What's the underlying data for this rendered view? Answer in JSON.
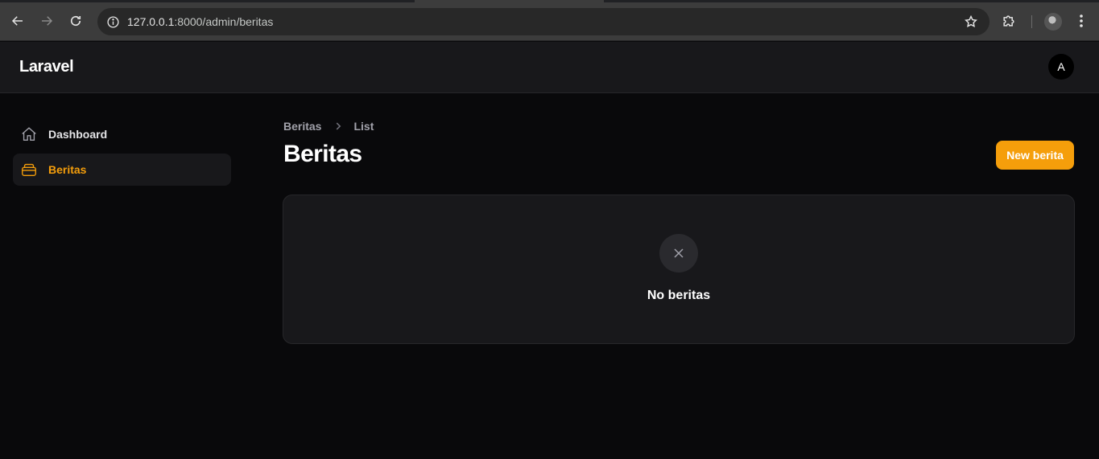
{
  "browser": {
    "url_host": "127.0.0.1",
    "url_rest": ":8000/admin/beritas",
    "icons": {
      "back": "arrow-left-icon",
      "forward": "arrow-right-icon",
      "reload": "reload-icon",
      "site_info": "info-icon",
      "bookmark": "star-icon",
      "extensions": "puzzle-icon",
      "menu": "more-vertical-icon"
    }
  },
  "app": {
    "brand": "Laravel",
    "avatar_initial": "A",
    "accent_color": "#f59e0b"
  },
  "sidebar": {
    "items": [
      {
        "label": "Dashboard",
        "icon": "home-icon",
        "active": false
      },
      {
        "label": "Beritas",
        "icon": "inbox-stack-icon",
        "active": true
      }
    ]
  },
  "main": {
    "breadcrumb": [
      "Beritas",
      "List"
    ],
    "title": "Beritas",
    "new_button_label": "New berita",
    "empty_state": {
      "icon": "x-mark-icon",
      "text": "No beritas"
    }
  }
}
